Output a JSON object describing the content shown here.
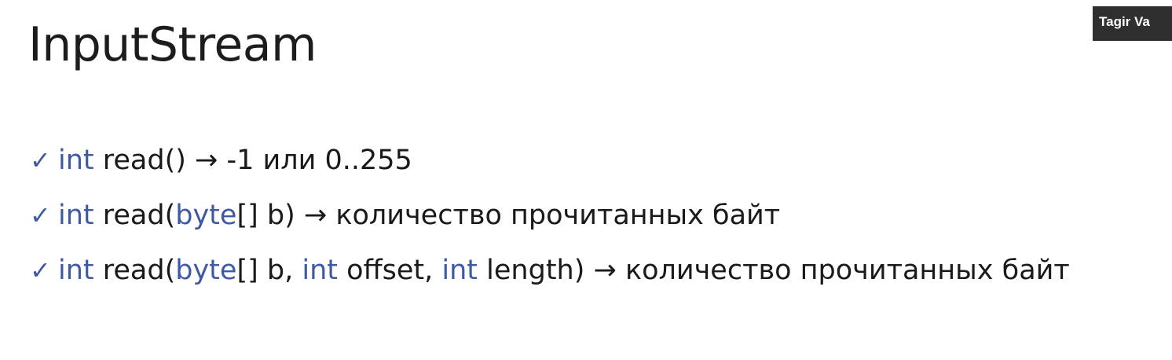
{
  "slide": {
    "title": "InputStream",
    "watermark": "Tagir Va",
    "keyword_color": "#3f5aa2",
    "check_icon": "checkmark-icon",
    "bullets": [
      {
        "parts": [
          {
            "kw": "int"
          },
          {
            "t": " read() "
          },
          {
            "arrow": "→"
          },
          {
            "t": " -1 или 0..255"
          }
        ]
      },
      {
        "parts": [
          {
            "kw": "int"
          },
          {
            "t": " read("
          },
          {
            "kw": "byte"
          },
          {
            "t": "[] b) "
          },
          {
            "arrow": "→"
          },
          {
            "t": " количество прочитанных байт"
          }
        ]
      },
      {
        "parts": [
          {
            "kw": "int"
          },
          {
            "t": " read("
          },
          {
            "kw": "byte"
          },
          {
            "t": "[] b, "
          },
          {
            "kw": "int"
          },
          {
            "t": " offset, "
          },
          {
            "kw": "int"
          },
          {
            "t": " length) "
          },
          {
            "arrow": "→"
          },
          {
            "t": " количество прочитанных байт"
          }
        ]
      }
    ]
  }
}
